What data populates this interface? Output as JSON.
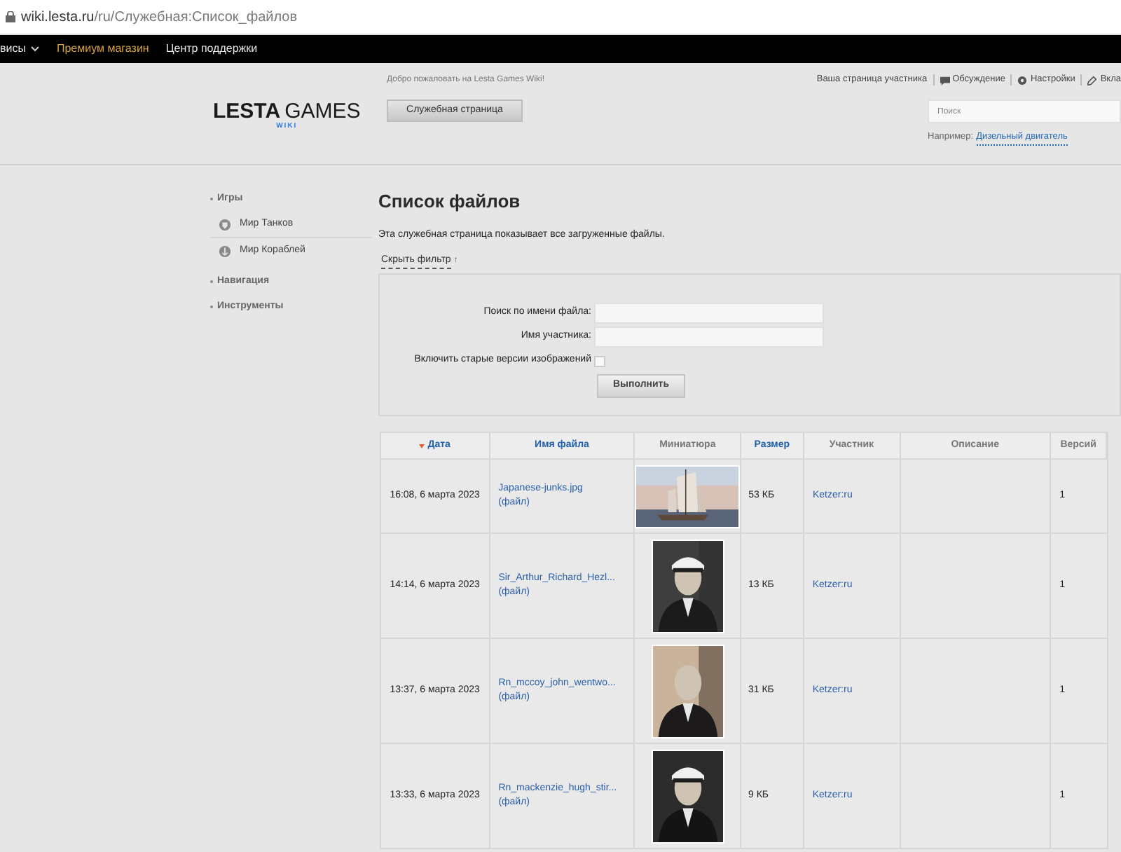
{
  "browser": {
    "url_host": "wiki.lesta.ru",
    "url_path": "/ru/Служебная:Список_файлов"
  },
  "topnav": [
    {
      "label": "висы",
      "kind": "dropdown"
    },
    {
      "label": "Премиум магазин",
      "kind": "premium"
    },
    {
      "label": "Центр поддержки",
      "kind": "plain"
    }
  ],
  "header": {
    "welcome": "Добро пожаловать на Lesta Games Wiki!",
    "logo_main": "LESTA",
    "logo_second": "GAMES",
    "logo_sub": "WIKI",
    "page_button": "Служебная страница",
    "user_links": [
      {
        "label": "Ваша страница участника",
        "kind": "plain"
      },
      {
        "label": "Обсуждение",
        "kind": "talk"
      },
      {
        "label": "Настройки",
        "kind": "settings"
      },
      {
        "label": "Вкла",
        "kind": "edit"
      }
    ],
    "search": {
      "placeholder": "Поиск"
    },
    "example_label": "Например:",
    "example_link": "Дизельный двигатель"
  },
  "sidebar": [
    {
      "label": "Игры",
      "children": [
        {
          "label": "Мир Танков",
          "kind": "tanks"
        },
        {
          "label": "Мир Кораблей",
          "kind": "ships"
        }
      ]
    },
    {
      "label": "Навигация"
    },
    {
      "label": "Инструменты"
    }
  ],
  "content": {
    "title": "Список файлов",
    "description": "Эта служебная страница показывает все загруженные файлы.",
    "filter_toggle": "Скрыть фильтр",
    "filter_arrow": "↑",
    "filter": [
      {
        "label": "Поиск по имени файла:",
        "kind": "text"
      },
      {
        "label": "Имя участника:",
        "kind": "text"
      },
      {
        "label": "Включить старые версии изображений",
        "kind": "checkbox",
        "checked": false
      }
    ],
    "submit": "Выполнить"
  },
  "table": {
    "columns": [
      {
        "label": "Дата",
        "sortable": true,
        "sorted": true
      },
      {
        "label": "Имя файла",
        "sortable": true,
        "sorted": false
      },
      {
        "label": "Миниатюра",
        "sortable": false,
        "sorted": false
      },
      {
        "label": "Размер",
        "sortable": true,
        "sorted": false
      },
      {
        "label": "Участник",
        "sortable": false,
        "sorted": false
      },
      {
        "label": "Описание",
        "sortable": false,
        "sorted": false
      },
      {
        "label": "Версий",
        "sortable": false,
        "sorted": false
      }
    ],
    "rows": [
      {
        "date": "16:08, 6 марта 2023",
        "file": "Japanese-junks.jpg",
        "file_link": "(файл)",
        "thumb": {
          "kind": "ship"
        },
        "size": "53 КБ",
        "user": "Ketzer:ru",
        "versions": "1"
      },
      {
        "date": "14:14, 6 марта 2023",
        "file": "Sir_Arthur_Richard_Hezl...",
        "file_link": "(файл)",
        "thumb": {
          "kind": "portrait_dark"
        },
        "size": "13 КБ",
        "user": "Ketzer:ru",
        "versions": "1"
      },
      {
        "date": "13:37, 6 марта 2023",
        "file": "Rn_mccoy_john_wentwo...",
        "file_link": "(файл)",
        "thumb": {
          "kind": "portrait_sepia"
        },
        "size": "31 КБ",
        "user": "Ketzer:ru",
        "versions": "1"
      },
      {
        "date": "13:33, 6 марта 2023",
        "file": "Rn_mackenzie_hugh_stir...",
        "file_link": "(файл)",
        "thumb": {
          "kind": "portrait_bw"
        },
        "size": "9 КБ",
        "user": "Ketzer:ru",
        "versions": "1"
      }
    ]
  }
}
